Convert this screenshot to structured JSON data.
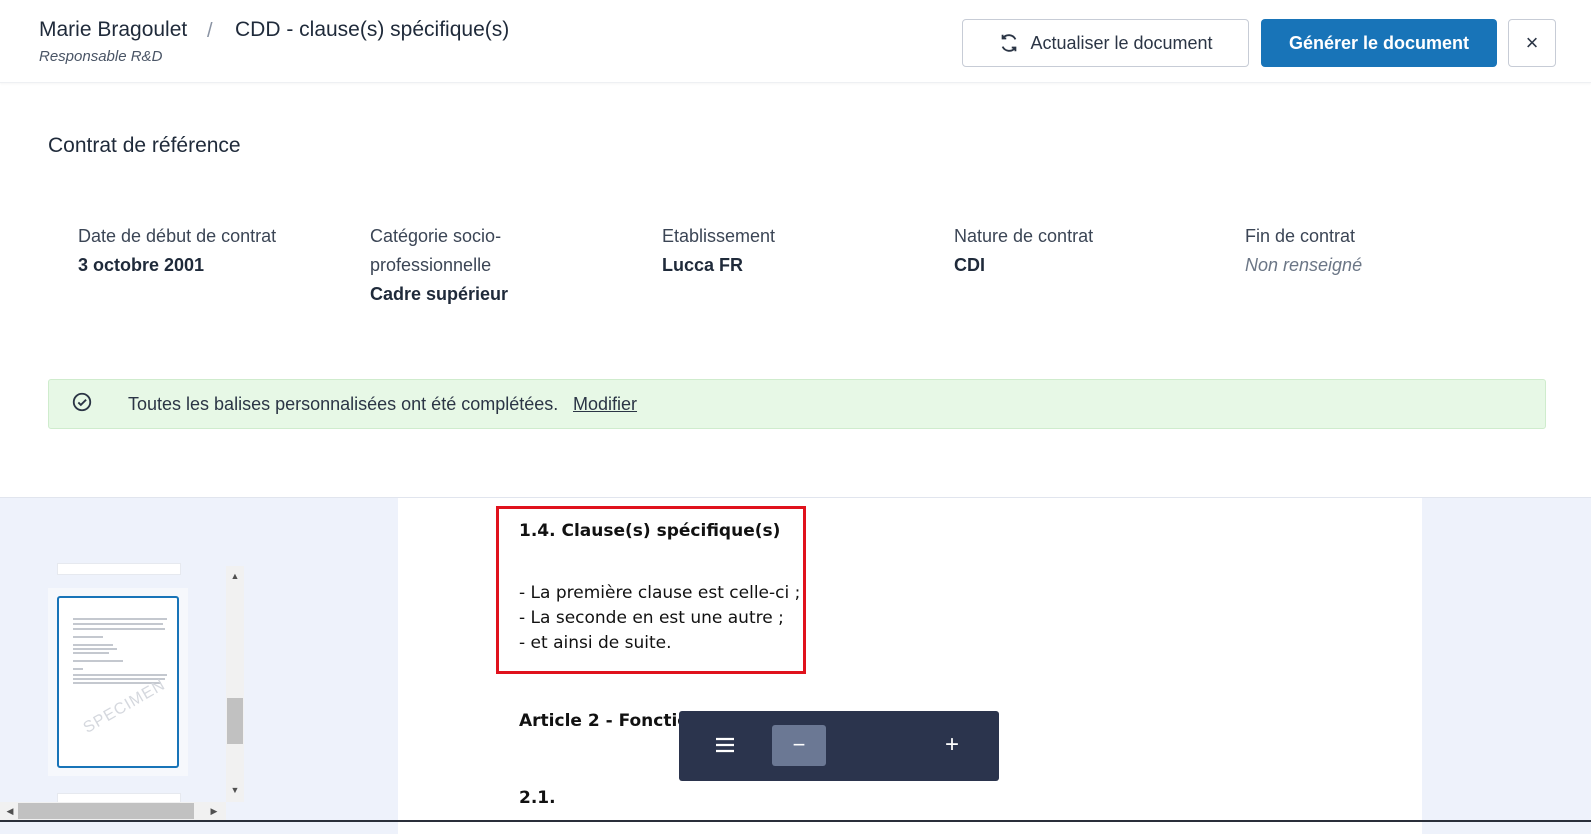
{
  "header": {
    "person_name": "Marie Bragoulet",
    "person_role": "Responsable R&D",
    "breadcrumb_separator": "/",
    "document_title": "CDD - clause(s) spécifique(s)",
    "refresh_label": "Actualiser le document",
    "generate_label": "Générer le document",
    "close_label": "×"
  },
  "contract": {
    "section_title": "Contrat de référence",
    "fields": [
      {
        "label": "Date de début de contrat",
        "value": "3 octobre 2001"
      },
      {
        "label": "Catégorie socio-professionnelle",
        "value": "Cadre supérieur"
      },
      {
        "label": "Etablissement",
        "value": "Lucca FR"
      },
      {
        "label": "Nature de contrat",
        "value": "CDI"
      },
      {
        "label": "Fin de contrat",
        "value": "Non renseigné"
      }
    ]
  },
  "banner": {
    "message": "Toutes les balises personnalisées ont été complétées.",
    "link": "Modifier",
    "icon": "check-circle-icon",
    "background": "#e7f8e6"
  },
  "document": {
    "clause_heading": "1.4.  Clause(s) spécifique(s)",
    "clause_lines": [
      "- La première clause est celle-ci ;",
      "- La seconde en est une autre ;",
      "- et ainsi de suite."
    ],
    "article_heading": "Article 2 - Fonctions",
    "sub_heading": "2.1."
  },
  "thumbnail": {
    "watermark": "SPECIMEN"
  },
  "zoom_toolbar": {
    "minus_label": "−",
    "plus_label": "+"
  },
  "colors": {
    "primary": "#1874b8",
    "highlight_border": "#e0121d",
    "toolbar": "#2b344d"
  }
}
